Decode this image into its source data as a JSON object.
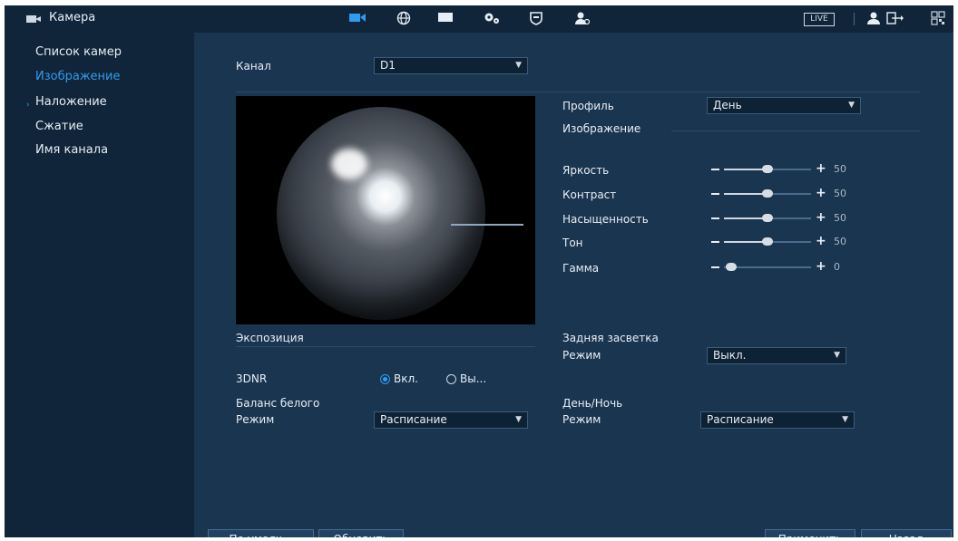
{
  "topbar": {
    "title": "Камера",
    "icons": [
      "camera-icon",
      "network-icon",
      "storage-icon",
      "settings-icon",
      "security-icon",
      "account-icon"
    ],
    "live_label": "LIVE",
    "accent_color": "#2f9cf0"
  },
  "sidebar": {
    "items": [
      {
        "label": "Список камер"
      },
      {
        "label": "Изображение"
      },
      {
        "label": "Наложение"
      },
      {
        "label": "Сжатие"
      },
      {
        "label": "Имя канала"
      }
    ]
  },
  "main": {
    "channel_label": "Канал",
    "channel_value": "D1",
    "profile_label": "Профиль",
    "profile_value": "День",
    "image_section": "Изображение",
    "sliders": [
      {
        "label": "Яркость",
        "value": "50"
      },
      {
        "label": "Контраст",
        "value": "50"
      },
      {
        "label": "Насыщенность",
        "value": "50"
      },
      {
        "label": "Тон",
        "value": "50"
      },
      {
        "label": "Гамма",
        "value": "0"
      }
    ],
    "exposure_label": "Экспозиция",
    "backlight_label": "Задняя засветка",
    "backlight_mode_label": "Режим",
    "backlight_mode_value": "Выкл.",
    "dnr_label": "3DNR",
    "dnr_on": "Вкл.",
    "dnr_off": "Вы...",
    "wb_label": "Баланс белого",
    "wb_mode_label": "Режим",
    "wb_mode_value": "Расписание",
    "daynight_label": "День/Ночь",
    "daynight_mode_label": "Режим",
    "daynight_mode_value": "Расписание"
  },
  "buttons": {
    "default": "По умолч...",
    "refresh": "Обновить",
    "apply": "Применить",
    "back": "Назад"
  }
}
